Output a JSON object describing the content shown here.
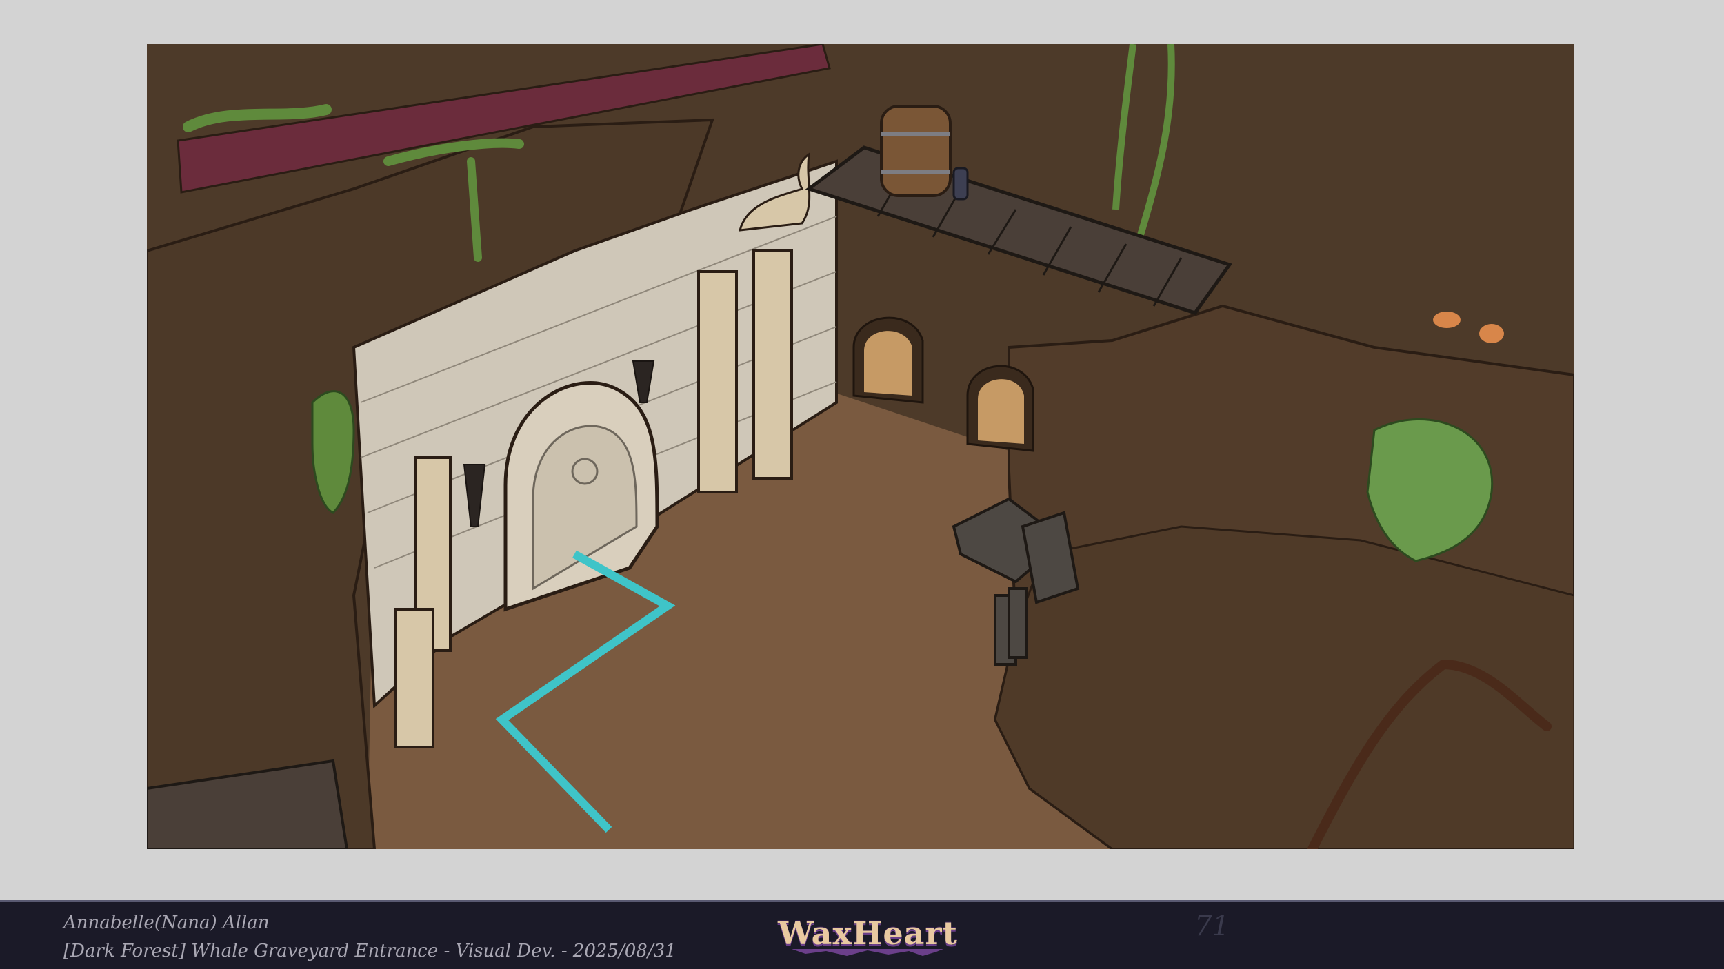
{
  "footer": {
    "author": "Annabelle(Nana) Allan",
    "caption": "[Dark Forest] Whale Graveyard Entrance - Visual Dev. - 2025/08/31",
    "logo_text": "WaxHeart",
    "page_mark": "71"
  },
  "colors": {
    "page_background": "#d3d3d3",
    "footer_background": "#1b1a28",
    "cave_wall": "#4a3828",
    "dirt_floor": "#7a5a40",
    "stone_wall": "#cfc7b8",
    "moss": "#5f8a3c",
    "crimson_beam": "#6b2c3c",
    "path_marker": "#3fc4c8"
  },
  "icons": {
    "logo": "waxheart-logo-icon"
  }
}
